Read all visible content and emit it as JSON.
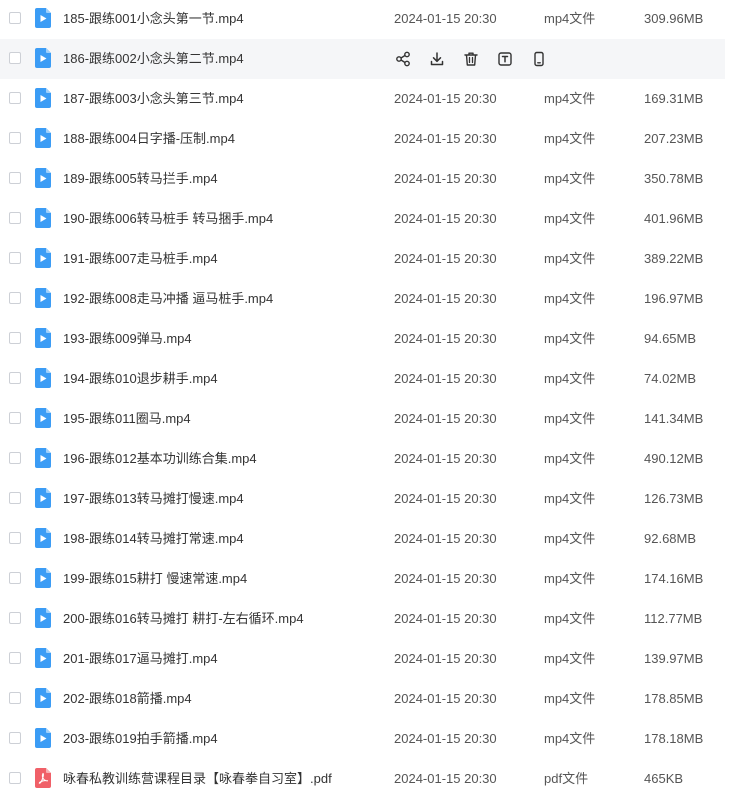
{
  "files": [
    {
      "name": "185-跟练001小念头第一节.mp4",
      "date": "2024-01-15 20:30",
      "type": "mp4文件",
      "size": "309.96MB",
      "icon": "video-file-icon"
    },
    {
      "name": "186-跟练002小念头第二节.mp4",
      "date": "",
      "type": "",
      "size": "",
      "icon": "video-file-icon",
      "hover": true
    },
    {
      "name": "187-跟练003小念头第三节.mp4",
      "date": "2024-01-15 20:30",
      "type": "mp4文件",
      "size": "169.31MB",
      "icon": "video-file-icon"
    },
    {
      "name": "188-跟练004日字播-压制.mp4",
      "date": "2024-01-15 20:30",
      "type": "mp4文件",
      "size": "207.23MB",
      "icon": "video-file-icon"
    },
    {
      "name": "189-跟练005转马拦手.mp4",
      "date": "2024-01-15 20:30",
      "type": "mp4文件",
      "size": "350.78MB",
      "icon": "video-file-icon"
    },
    {
      "name": "190-跟练006转马桩手 转马捆手.mp4",
      "date": "2024-01-15 20:30",
      "type": "mp4文件",
      "size": "401.96MB",
      "icon": "video-file-icon"
    },
    {
      "name": "191-跟练007走马桩手.mp4",
      "date": "2024-01-15 20:30",
      "type": "mp4文件",
      "size": "389.22MB",
      "icon": "video-file-icon"
    },
    {
      "name": "192-跟练008走马冲播 逼马桩手.mp4",
      "date": "2024-01-15 20:30",
      "type": "mp4文件",
      "size": "196.97MB",
      "icon": "video-file-icon"
    },
    {
      "name": "193-跟练009弹马.mp4",
      "date": "2024-01-15 20:30",
      "type": "mp4文件",
      "size": "94.65MB",
      "icon": "video-file-icon"
    },
    {
      "name": "194-跟练010退步耕手.mp4",
      "date": "2024-01-15 20:30",
      "type": "mp4文件",
      "size": "74.02MB",
      "icon": "video-file-icon"
    },
    {
      "name": "195-跟练011圈马.mp4",
      "date": "2024-01-15 20:30",
      "type": "mp4文件",
      "size": "141.34MB",
      "icon": "video-file-icon"
    },
    {
      "name": "196-跟练012基本功训练合集.mp4",
      "date": "2024-01-15 20:30",
      "type": "mp4文件",
      "size": "490.12MB",
      "icon": "video-file-icon"
    },
    {
      "name": "197-跟练013转马摊打慢速.mp4",
      "date": "2024-01-15 20:30",
      "type": "mp4文件",
      "size": "126.73MB",
      "icon": "video-file-icon"
    },
    {
      "name": "198-跟练014转马摊打常速.mp4",
      "date": "2024-01-15 20:30",
      "type": "mp4文件",
      "size": "92.68MB",
      "icon": "video-file-icon"
    },
    {
      "name": "199-跟练015耕打 慢速常速.mp4",
      "date": "2024-01-15 20:30",
      "type": "mp4文件",
      "size": "174.16MB",
      "icon": "video-file-icon"
    },
    {
      "name": "200-跟练016转马摊打 耕打-左右循环.mp4",
      "date": "2024-01-15 20:30",
      "type": "mp4文件",
      "size": "112.77MB",
      "icon": "video-file-icon"
    },
    {
      "name": "201-跟练017逼马摊打.mp4",
      "date": "2024-01-15 20:30",
      "type": "mp4文件",
      "size": "139.97MB",
      "icon": "video-file-icon"
    },
    {
      "name": "202-跟练018箭播.mp4",
      "date": "2024-01-15 20:30",
      "type": "mp4文件",
      "size": "178.85MB",
      "icon": "video-file-icon"
    },
    {
      "name": "203-跟练019拍手箭播.mp4",
      "date": "2024-01-15 20:30",
      "type": "mp4文件",
      "size": "178.18MB",
      "icon": "video-file-icon"
    },
    {
      "name": "咏春私教训练营课程目录【咏春拳自习室】.pdf",
      "date": "2024-01-15 20:30",
      "type": "pdf文件",
      "size": "465KB",
      "icon": "pdf-file-icon"
    }
  ],
  "hover_actions": [
    "share-icon",
    "download-icon",
    "delete-icon",
    "text-extract-icon",
    "mobile-icon"
  ],
  "colors": {
    "video_icon": "#3b9cf5",
    "pdf_icon": "#f06068",
    "hover_row": "#f5f6f8",
    "action_icon": "#333333"
  }
}
